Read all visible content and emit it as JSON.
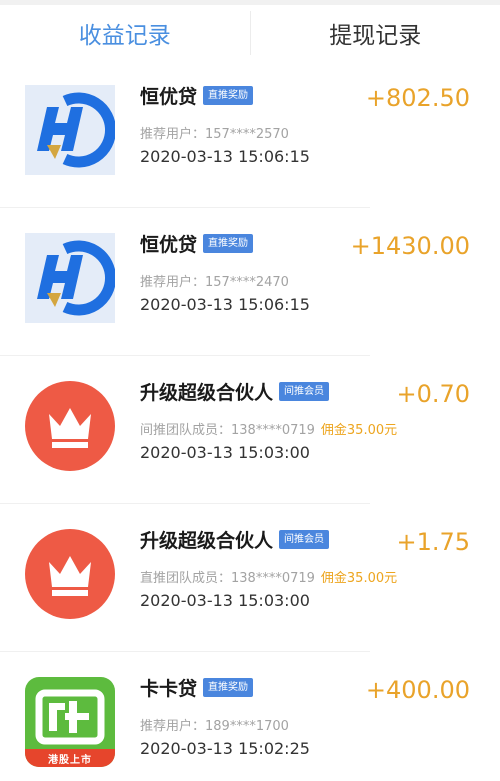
{
  "tabs": [
    {
      "label": "收益记录",
      "active": true
    },
    {
      "label": "提现记录",
      "active": false
    }
  ],
  "records": [
    {
      "title": "恒优贷",
      "badge": "直推奖励",
      "sub": "推荐用户：157****2570",
      "commission": "",
      "date": "2020-03-13 15:06:15",
      "amount": "+802.50",
      "icon": "hengyoudai-logo-icon"
    },
    {
      "title": "恒优贷",
      "badge": "直推奖励",
      "sub": "推荐用户：157****2470",
      "commission": "",
      "date": "2020-03-13 15:06:15",
      "amount": "+1430.00",
      "icon": "hengyoudai-logo-icon"
    },
    {
      "title": "升级超级合伙人",
      "badge": "间推会员",
      "sub": "间推团队成员：138****0719",
      "commission": "佣金35.00元",
      "date": "2020-03-13 15:03:00",
      "amount": "+0.70",
      "icon": "crown-icon"
    },
    {
      "title": "升级超级合伙人",
      "badge": "间推会员",
      "sub": "直推团队成员：138****0719",
      "commission": "佣金35.00元",
      "date": "2020-03-13 15:03:00",
      "amount": "+1.75",
      "icon": "crown-icon"
    },
    {
      "title": "卡卡贷",
      "badge": "直推奖励",
      "sub": "推荐用户：189****1700",
      "commission": "",
      "date": "2020-03-13 15:02:25",
      "amount": "+400.00",
      "icon": "kakadai-logo-icon",
      "icon_footer": "港股上市"
    }
  ],
  "colors": {
    "active_tab": "#4a8fe0",
    "amount": "#e9a32a",
    "badge": "#4a86de",
    "commission": "#eda51f",
    "crown_bg": "#ee5a45",
    "kakadai_bg": "#5dbb3e"
  }
}
